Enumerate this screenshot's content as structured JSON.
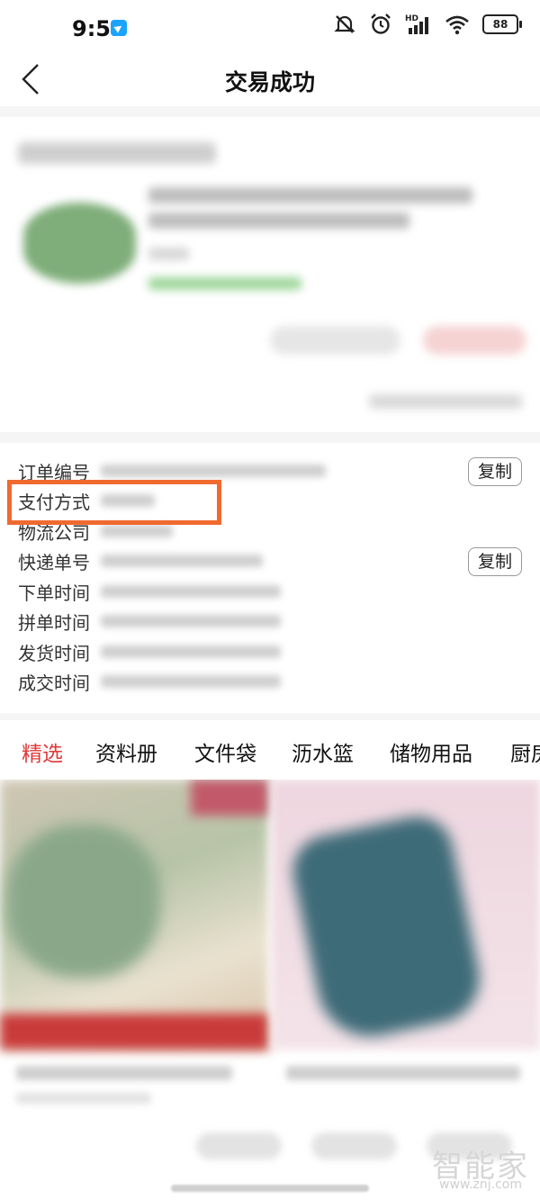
{
  "status_bar": {
    "time": "9:51",
    "battery": "88",
    "icons": [
      "mute-icon",
      "alarm-icon",
      "signal-hd-icon",
      "wifi-icon",
      "battery-icon"
    ]
  },
  "header": {
    "title": "交易成功",
    "back_icon": "chevron-left-icon"
  },
  "order_info": {
    "rows": [
      {
        "label": "订单编号",
        "has_copy": true
      },
      {
        "label": "支付方式",
        "has_copy": false
      },
      {
        "label": "物流公司",
        "has_copy": false
      },
      {
        "label": "快递单号",
        "has_copy": true
      },
      {
        "label": "下单时间",
        "has_copy": false
      },
      {
        "label": "拼单时间",
        "has_copy": false
      },
      {
        "label": "发货时间",
        "has_copy": false
      },
      {
        "label": "成交时间",
        "has_copy": false
      }
    ],
    "copy_label": "复制",
    "highlighted_row": "支付方式",
    "highlight_color": "#f06a30"
  },
  "category_tabs": {
    "items": [
      "精选",
      "资料册",
      "文件袋",
      "沥水篮",
      "储物用品",
      "厨房"
    ],
    "active": "精选",
    "active_color": "#e03a3a"
  },
  "watermark": {
    "logo": "智能家",
    "url": "www.znj.com"
  }
}
